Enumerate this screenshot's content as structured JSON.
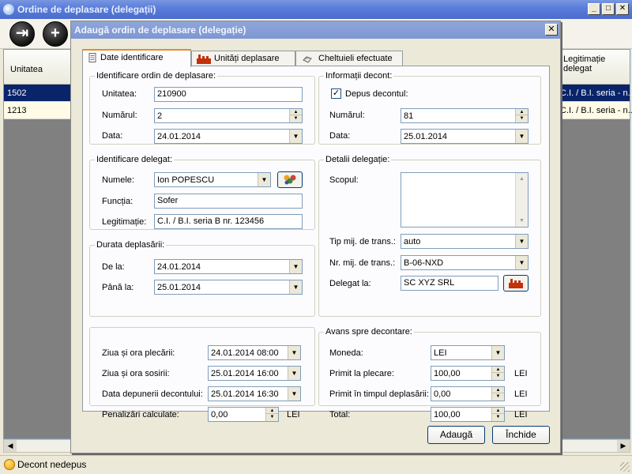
{
  "main_window": {
    "title": "Ordine de deplasare (delegații)",
    "toolbar": {
      "exit_icon": "exit-icon",
      "add_icon": "plus-icon"
    },
    "grid": {
      "columns": [
        "Unitatea",
        "Legitimație delegat"
      ],
      "rows": [
        {
          "unit": "1502",
          "id_doc": "C.I. / B.I. seria - n...",
          "selected": true
        },
        {
          "unit": "1213",
          "id_doc": "C.I. / B.I. seria - n...",
          "selected": false
        }
      ]
    },
    "status": "Decont nedepus"
  },
  "dialog": {
    "title": "Adaugă ordin de deplasare (delegație)",
    "tabs": [
      {
        "label": "Date identificare",
        "icon": "document-icon"
      },
      {
        "label": "Unități deplasare",
        "icon": "factory-icon"
      },
      {
        "label": "Cheltuieli efectuate",
        "icon": "hand-money-icon"
      }
    ],
    "order_group": {
      "legend": "Identificare ordin de deplasare:",
      "unit_label": "Unitatea:",
      "unit_value": "210900",
      "number_label": "Numărul:",
      "number_value": "2",
      "date_label": "Data:",
      "date_value": "24.01.2014"
    },
    "settlement_group": {
      "legend": "Informații decont:",
      "submitted_label": "Depus decontul:",
      "submitted": true,
      "number_label": "Numărul:",
      "number_value": "81",
      "date_label": "Data:",
      "date_value": "25.01.2014"
    },
    "delegate_group": {
      "legend": "Identificare delegat:",
      "name_label": "Numele:",
      "name_value": "Ion POPESCU",
      "function_label": "Funcția:",
      "function_value": "Sofer",
      "id_label": "Legitimație:",
      "id_value": "C.I. / B.I. seria B nr. 123456"
    },
    "details_group": {
      "legend": "Detalii delegație:",
      "purpose_label": "Scopul:",
      "purpose_value": "",
      "transport_type_label": "Tip mij. de trans.:",
      "transport_type_value": "auto",
      "transport_no_label": "Nr. mij. de trans.:",
      "transport_no_value": "B-06-NXD",
      "delegated_to_label": "Delegat la:",
      "delegated_to_value": "SC XYZ SRL"
    },
    "duration_group": {
      "legend": "Durata deplasării:",
      "from_label": "De la:",
      "from_value": "24.01.2014",
      "to_label": "Până la:",
      "to_value": "25.01.2014"
    },
    "times_group": {
      "departure_label": "Ziua și ora plecării:",
      "departure_value": "24.01.2014 08:00",
      "arrival_label": "Ziua și ora sosirii:",
      "arrival_value": "25.01.2014 16:00",
      "submission_label": "Data depunerii decontului:",
      "submission_value": "25.01.2014 16:30",
      "penalties_label": "Penalizări calculate:",
      "penalties_value": "0,00",
      "penalties_unit": "LEI"
    },
    "advance_group": {
      "legend": "Avans spre decontare:",
      "currency_label": "Moneda:",
      "currency_value": "LEI",
      "received_departure_label": "Primit la plecare:",
      "received_departure_value": "100,00",
      "received_departure_unit": "LEI",
      "received_during_label": "Primit în timpul deplasării:",
      "received_during_value": "0,00",
      "received_during_unit": "LEI",
      "total_label": "Total:",
      "total_value": "100,00",
      "total_unit": "LEI"
    },
    "buttons": {
      "add": "Adaugă",
      "close": "Închide"
    }
  }
}
